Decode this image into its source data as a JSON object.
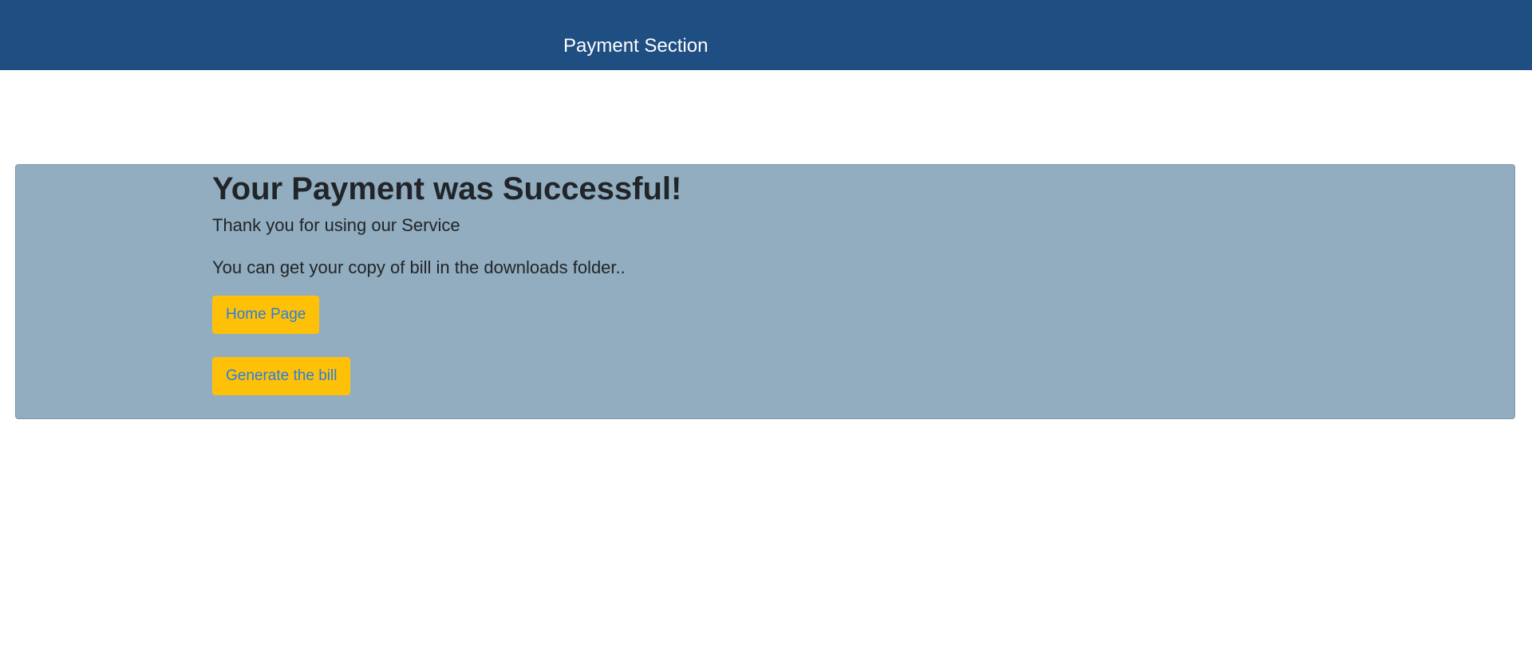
{
  "header": {
    "title": "Payment Section"
  },
  "panel": {
    "heading": "Your Payment was Successful!",
    "thanks": "Thank you for using our Service",
    "download_note": "You can get your copy of bill in the downloads folder..",
    "home_button": "Home Page",
    "bill_button": "Generate the bill"
  },
  "colors": {
    "header_bg": "#1f4e82",
    "panel_bg": "#92adbf",
    "button_bg": "#ffc107",
    "button_text": "#2a7de1",
    "body_text": "#212529"
  }
}
